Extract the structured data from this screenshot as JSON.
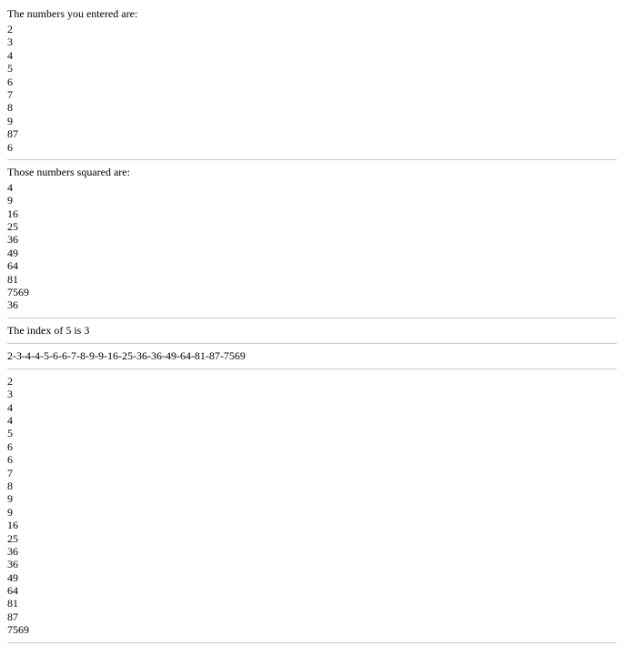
{
  "section1": {
    "heading": "The numbers you entered are:",
    "items": [
      "2",
      "3",
      "4",
      "5",
      "6",
      "7",
      "8",
      "9",
      "87",
      "6"
    ]
  },
  "section2": {
    "heading": "Those numbers squared are:",
    "items": [
      "4",
      "9",
      "16",
      "25",
      "36",
      "49",
      "64",
      "81",
      "7569",
      "36"
    ]
  },
  "index_text": "The index of 5 is 3",
  "joined_text": "2-3-4-4-5-6-6-7-8-9-9-16-25-36-36-49-64-81-87-7569",
  "section3": {
    "items": [
      "2",
      "3",
      "4",
      "4",
      "5",
      "6",
      "6",
      "7",
      "8",
      "9",
      "9",
      "16",
      "25",
      "36",
      "36",
      "49",
      "64",
      "81",
      "87",
      "7569"
    ]
  }
}
